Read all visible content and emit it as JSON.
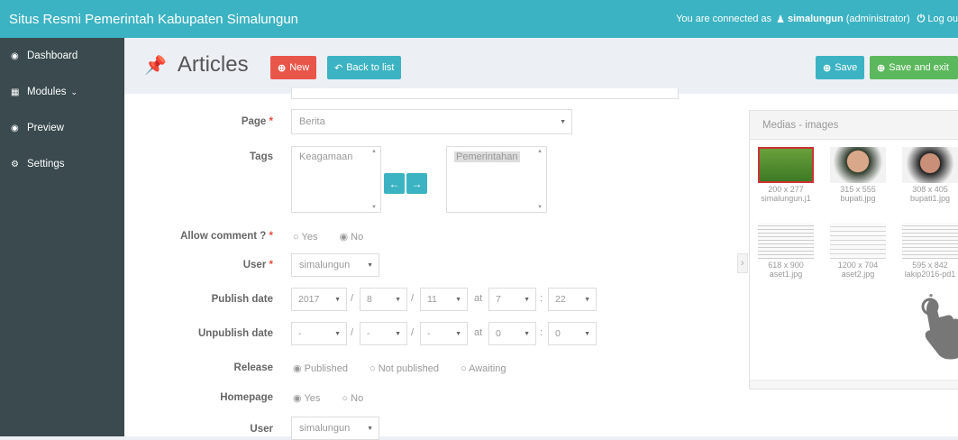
{
  "topbar": {
    "brand": "Situs Resmi Pemerintah Kabupaten Simalungun",
    "connected_prefix": "You are connected as",
    "username": "simalungun",
    "role": "(administrator)",
    "logout": "Log ou"
  },
  "sidebar": {
    "items": [
      {
        "label": "Dashboard",
        "icon": "dashboard-icon"
      },
      {
        "label": "Modules",
        "icon": "modules-icon"
      },
      {
        "label": "Preview",
        "icon": "eye-icon"
      },
      {
        "label": "Settings",
        "icon": "gear-icon"
      }
    ]
  },
  "header": {
    "title": "Articles",
    "new_label": "New",
    "back_label": "Back to list",
    "save_label": "Save",
    "save_exit_label": "Save and exit"
  },
  "form": {
    "page_label": "Page",
    "page_value": "Berita",
    "tags_label": "Tags",
    "tags_available": "Keagamaan",
    "tags_selected": "Pemerintahan",
    "allow_comment_label": "Allow comment ?",
    "allow_yes": "Yes",
    "allow_no": "No",
    "user_label": "User",
    "user_value": "simalungun",
    "publish_label": "Publish date",
    "publish_year": "2017",
    "publish_month": "8",
    "publish_day": "11",
    "publish_at": "at",
    "publish_hour": "7",
    "publish_minute": "22",
    "unpublish_label": "Unpublish date",
    "unpublish_year": "-",
    "unpublish_month": "-",
    "unpublish_day": "-",
    "unpublish_at": "at",
    "unpublish_hour": "0",
    "unpublish_minute": "0",
    "release_label": "Release",
    "release_published": "Published",
    "release_not_published": "Not published",
    "release_awaiting": "Awaiting",
    "homepage_label": "Homepage",
    "homepage_yes": "Yes",
    "homepage_no": "No",
    "user2_label": "User",
    "user2_value": "simalungun",
    "sep_slash": "/",
    "sep_colon": ":"
  },
  "media": {
    "title": "Medias - images",
    "items": [
      {
        "size": "200 x 277",
        "name": "simalungun.j1"
      },
      {
        "size": "315 x 555",
        "name": "bupati.jpg"
      },
      {
        "size": "308 x 405",
        "name": "bupati1.jpg"
      },
      {
        "size": "618 x 900",
        "name": "aset1.jpg"
      },
      {
        "size": "1200 x 704",
        "name": "aset2.jpg"
      },
      {
        "size": "595 x 842",
        "name": "lakip2016-pd1"
      }
    ]
  },
  "colors": {
    "accent": "#3bb3c3",
    "danger": "#e8564a",
    "success": "#5cb85c",
    "sidebar": "#3a4a4f"
  }
}
